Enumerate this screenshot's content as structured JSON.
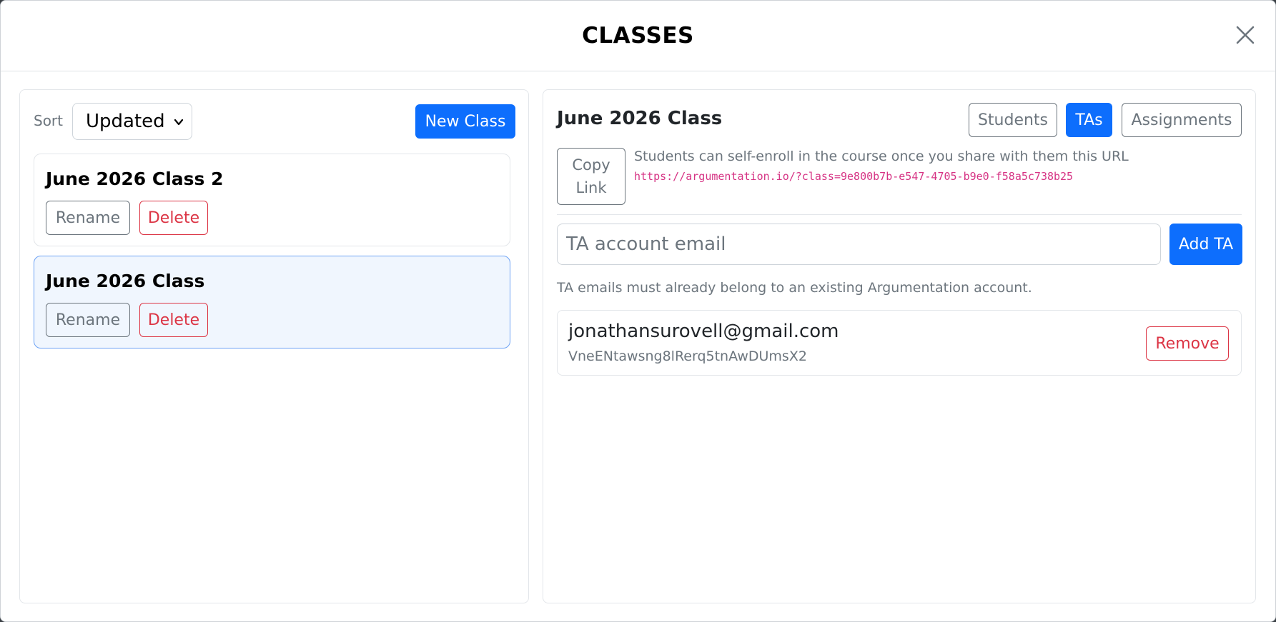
{
  "modal": {
    "title": "CLASSES"
  },
  "left": {
    "sort_label": "Sort",
    "sort_value": "Updated",
    "new_class_label": "New Class",
    "classes": [
      {
        "name": "June 2026 Class 2",
        "rename_label": "Rename",
        "delete_label": "Delete",
        "active": false
      },
      {
        "name": "June 2026 Class",
        "rename_label": "Rename",
        "delete_label": "Delete",
        "active": true
      }
    ]
  },
  "right": {
    "class_title": "June 2026 Class",
    "tabs": [
      {
        "label": "Students",
        "active": false
      },
      {
        "label": "TAs",
        "active": true
      },
      {
        "label": "Assignments",
        "active": false
      }
    ],
    "copy_link_label": "Copy Link",
    "enroll_text": "Students can self-enroll in the course once you share with them this URL",
    "enroll_url": "https://argumentation.io/?class=9e800b7b-e547-4705-b9e0-f58a5c738b25",
    "ta_input_placeholder": "TA account email",
    "add_ta_label": "Add TA",
    "help_text": "TA emails must already belong to an existing Argumentation account.",
    "tas": [
      {
        "email": "jonathansurovell@gmail.com",
        "uid": "VneENtawsng8lRerq5tnAwDUmsX2",
        "remove_label": "Remove"
      }
    ]
  },
  "colors": {
    "primary": "#0d6efd",
    "secondary": "#6c757d",
    "danger": "#dc3545",
    "url": "#d63384",
    "active_card": "#f0f6fe"
  }
}
